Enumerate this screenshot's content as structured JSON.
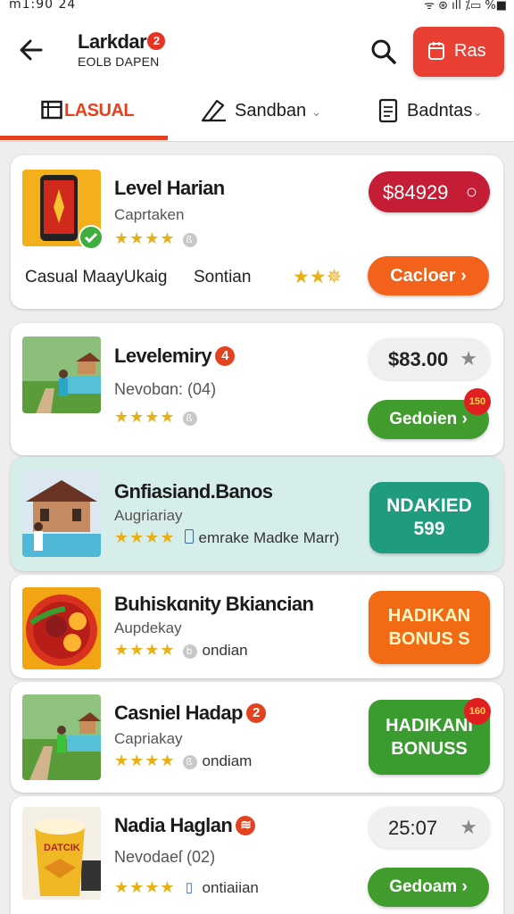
{
  "status_bar": {
    "time": "m1:90  24",
    "icons": "ᯤ ⊛ ıll ⁒▭ %■"
  },
  "header": {
    "title": "Larkdar",
    "title_badge": "2",
    "subtitle": "EOLB DAPEN",
    "action_label": "Ras"
  },
  "tabs": [
    {
      "label": "LASUAL",
      "icon": "calendar-icon",
      "active": true
    },
    {
      "label": "Sandban",
      "icon": "pencil-icon",
      "active": false
    },
    {
      "label": "Badntas",
      "icon": "document-icon",
      "active": false
    }
  ],
  "chevron": "⌄",
  "items": [
    {
      "title": "Level Harian",
      "subtitle": "Caprtaken",
      "stars": "★★★★",
      "mini": "ß",
      "extra_left": "Casual MaayUkaig",
      "extra_mid": "Sontian",
      "extra_stars": "★★✵",
      "price": "$84929",
      "price_icon": "○",
      "action": "Cacloer ›",
      "colors": {
        "price_bg": "#c41d35",
        "action_bg": "#f2621b"
      }
    },
    {
      "title": "Levelemiry",
      "badge": "4",
      "subtitle": "Nevobɑn: (04)",
      "stars": "★★★★",
      "mini": "ß",
      "price": "$83.00",
      "price_icon": "★",
      "action": "Gedoien ›",
      "burst": "150",
      "colors": {
        "action_bg": "#3f9c2d"
      }
    },
    {
      "title": "Gnfiasiand.Banos",
      "subtitle": "Augriariay",
      "stars": "★★★★",
      "extra": "emrake Madke Marr)",
      "action": "NDAKIED 599",
      "colors": {
        "action_bg": "#1f9b80"
      }
    },
    {
      "title": "Buhiskɑnity Bkiancian",
      "subtitle": "Aupdekay",
      "stars": "★★★★",
      "mini": "b",
      "extra": "ondian",
      "action": "HADIKAN BONUS S",
      "colors": {
        "action_bg": "#f26a14"
      }
    },
    {
      "title": "Casniel Hadap",
      "badge": "2",
      "subtitle": "Capriakay",
      "stars": "★★★★",
      "mini": "ß",
      "extra": "ondiam",
      "action": "HADIKANI BONUSS",
      "burst": "160",
      "colors": {
        "action_bg": "#3a9b2e"
      }
    },
    {
      "title": "Nadia Haglan",
      "badge": "≋",
      "subtitle": "Nevodaeſ (02)",
      "stars": "★★★★",
      "mini": "▯",
      "extra": "ontiaiian",
      "price": "25:07",
      "price_icon": "★",
      "action": "Gedoam ›",
      "thumb_text": "DATCIK",
      "colors": {
        "action_bg": "#3f9c2d"
      }
    }
  ]
}
